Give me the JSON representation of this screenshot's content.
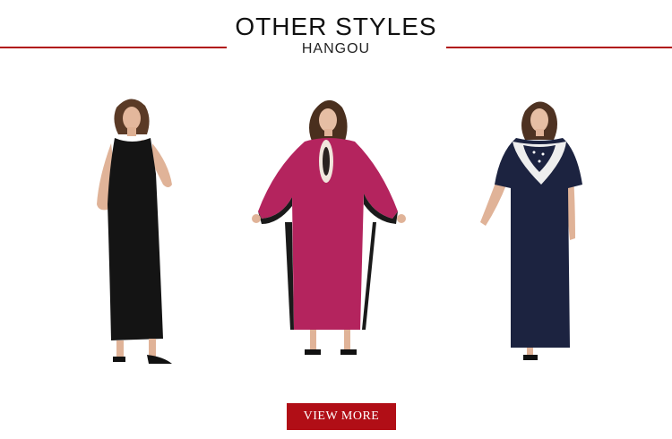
{
  "header": {
    "title": "OTHER STYLES",
    "subtitle": "HANGOU"
  },
  "accent_color": "#b10e16",
  "products": [
    {
      "icon": "black-sleeveless-maxi-dress-photo",
      "dress_color": "#141414"
    },
    {
      "icon": "magenta-batwing-kaftan-dress-photo",
      "dress_color": "#b4245e"
    },
    {
      "icon": "navy-lace-trim-maxi-dress-photo",
      "dress_color": "#1c2340"
    }
  ],
  "cta": {
    "label": "VIEW MORE"
  }
}
